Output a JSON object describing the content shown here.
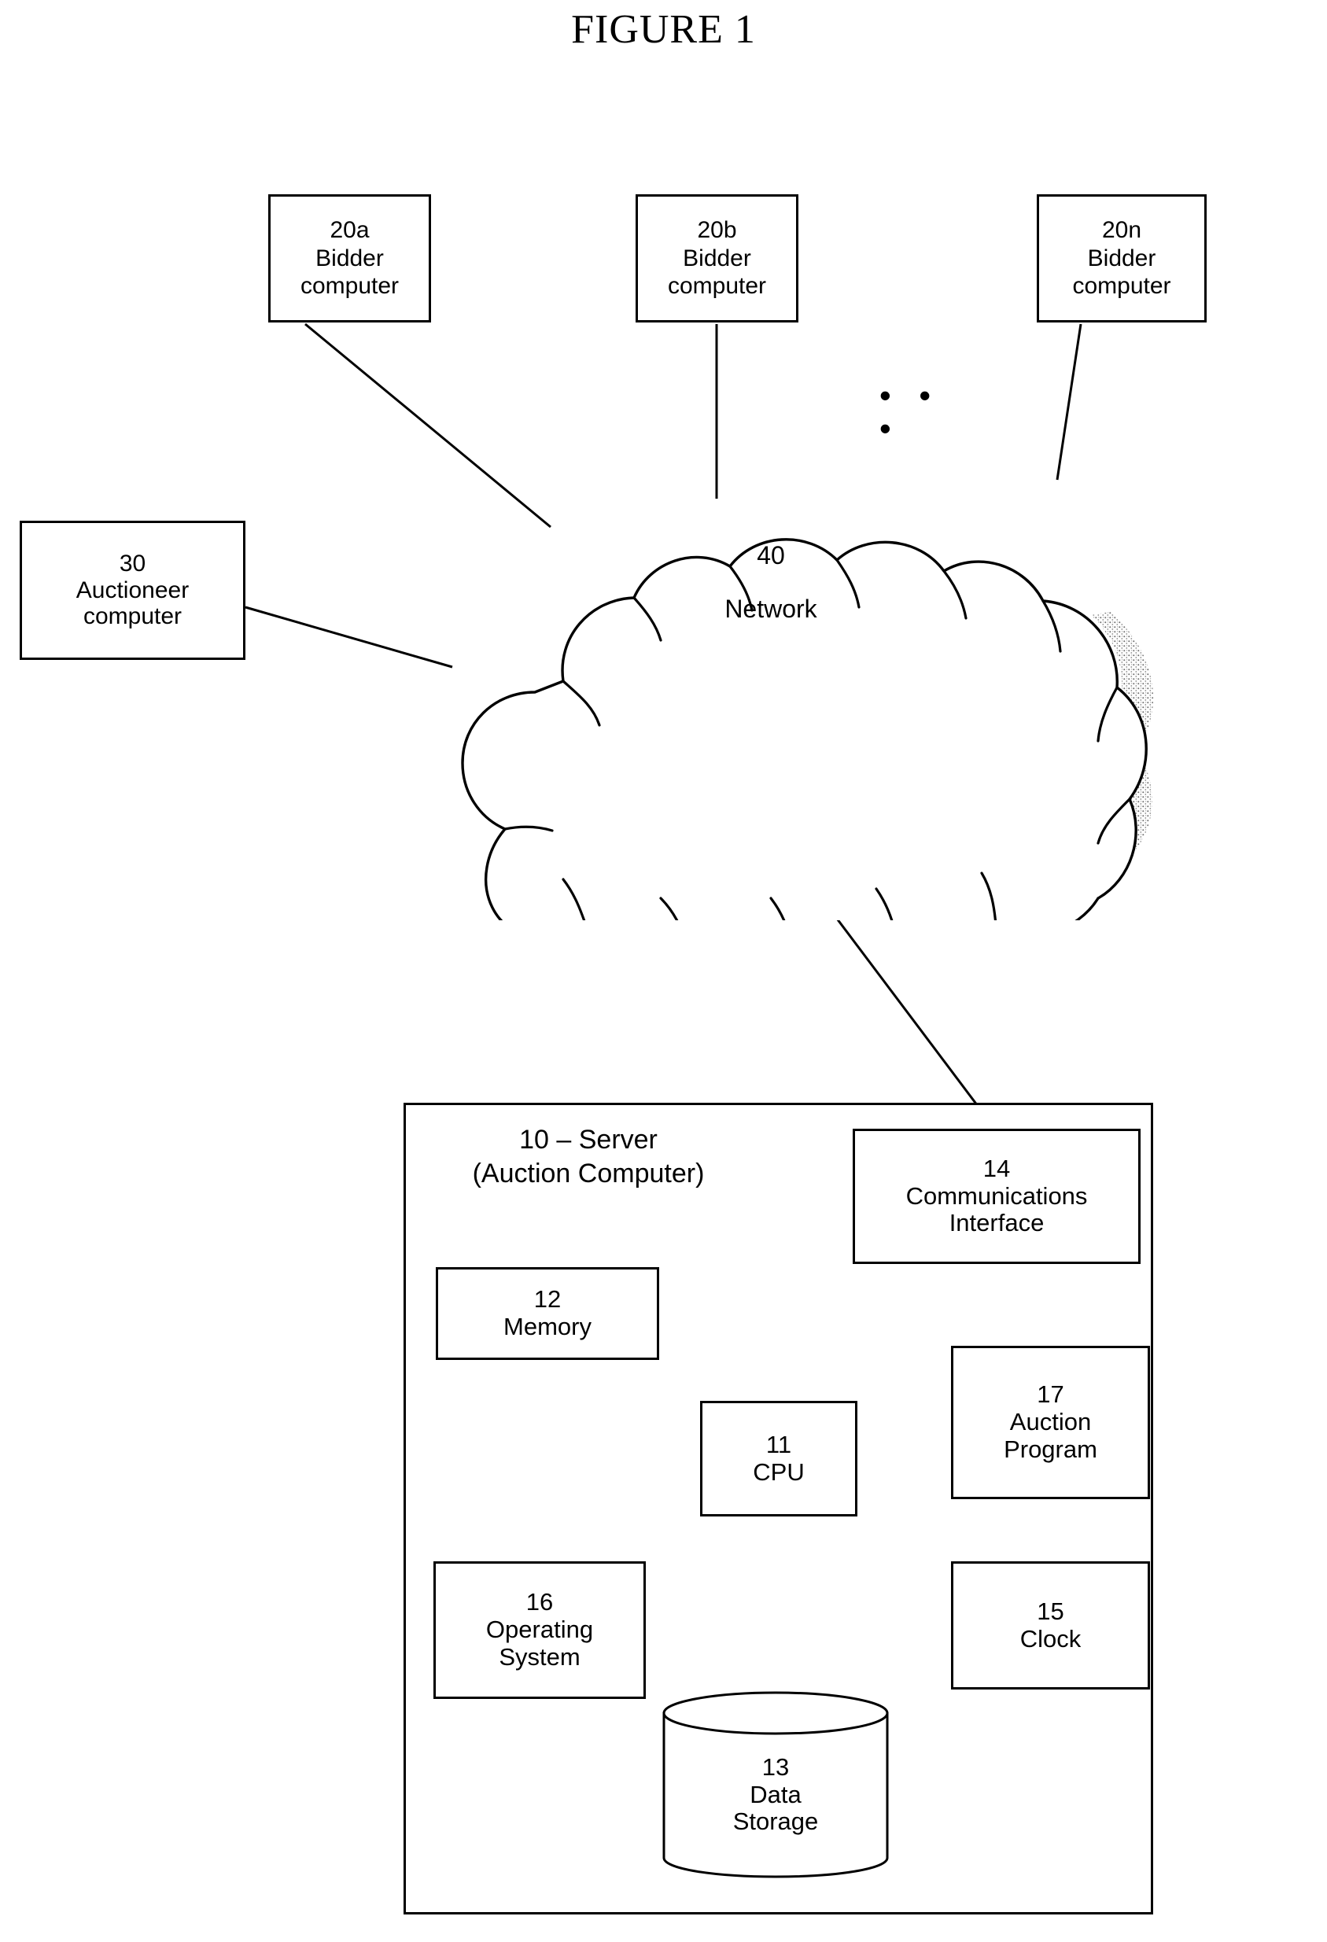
{
  "figure": {
    "title": "FIGURE 1"
  },
  "diagram": {
    "ellipsis": "• • •",
    "nodes": {
      "bidder_a": {
        "ref": "20a",
        "line2": "Bidder",
        "line3": "computer"
      },
      "bidder_b": {
        "ref": "20b",
        "line2": "Bidder",
        "line3": "computer"
      },
      "bidder_n": {
        "ref": "20n",
        "line2": "Bidder",
        "line3": "computer"
      },
      "auctioneer": {
        "ref": "30",
        "line2": "Auctioneer",
        "line3": "computer"
      },
      "network": {
        "ref": "40",
        "label": "Network"
      },
      "server": {
        "title_line1": "10 – Server",
        "title_line2": "(Auction Computer)"
      },
      "communications_interface": {
        "ref": "14",
        "line2": "Communications",
        "line3": "Interface"
      },
      "memory": {
        "ref": "12",
        "line2": "Memory"
      },
      "cpu": {
        "ref": "11",
        "line2": "CPU"
      },
      "auction_program": {
        "ref": "17",
        "line2": "Auction",
        "line3": "Program"
      },
      "operating_system": {
        "ref": "16",
        "line2": "Operating",
        "line3": "System"
      },
      "clock": {
        "ref": "15",
        "line2": "Clock"
      },
      "data_storage": {
        "ref": "13",
        "line2": "Data",
        "line3": "Storage"
      }
    },
    "colors": {
      "stroke": "#000000",
      "background": "#ffffff",
      "shadow": "#8a8a8a"
    }
  }
}
